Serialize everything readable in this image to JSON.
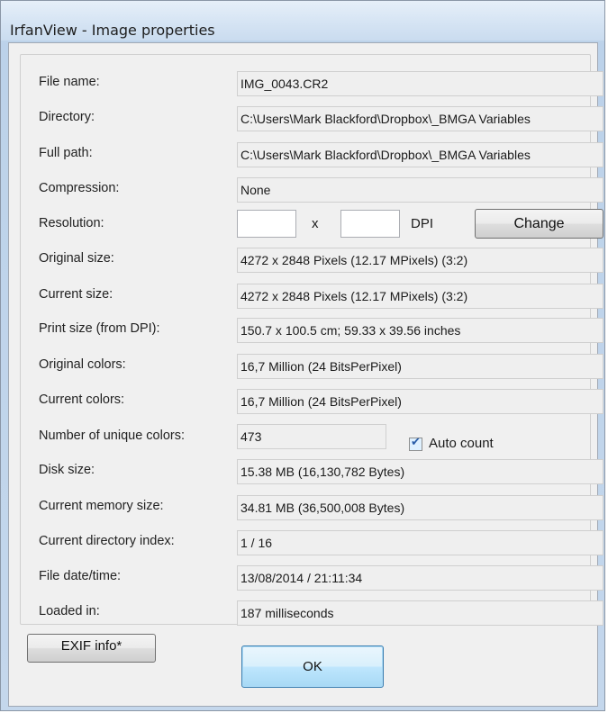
{
  "window": {
    "title": "IrfanView - Image properties"
  },
  "fields": [
    {
      "label": "File name:",
      "value": "IMG_0043.CR2"
    },
    {
      "label": "Directory:",
      "value": "C:\\Users\\Mark Blackford\\Dropbox\\_BMGA Variables"
    },
    {
      "label": "Full path:",
      "value": "C:\\Users\\Mark Blackford\\Dropbox\\_BMGA Variables"
    },
    {
      "label": "Compression:",
      "value": "None"
    },
    {
      "label": "Original size:",
      "value": "4272 x 2848  Pixels (12.17 MPixels) (3:2)"
    },
    {
      "label": "Current size:",
      "value": "4272 x 2848  Pixels (12.17 MPixels) (3:2)"
    },
    {
      "label": "Print size (from DPI):",
      "value": "150.7 x 100.5 cm; 59.33 x 39.56 inches"
    },
    {
      "label": "Original colors:",
      "value": "16,7 Million  (24 BitsPerPixel)"
    },
    {
      "label": "Current colors:",
      "value": "16,7 Million  (24 BitsPerPixel)"
    },
    {
      "label": "Disk size:",
      "value": "15.38 MB (16,130,782 Bytes)"
    },
    {
      "label": "Current memory size:",
      "value": "34.81  MB (36,500,008 Bytes)"
    },
    {
      "label": "Current directory index:",
      "value": "1  /  16"
    },
    {
      "label": "File date/time:",
      "value": "13/08/2014 / 21:11:34"
    },
    {
      "label": "Loaded in:",
      "value": "187 milliseconds"
    }
  ],
  "resolution": {
    "label": "Resolution:",
    "x_value": "",
    "y_value": "",
    "separator": "x",
    "unit": "DPI",
    "change_button": "Change"
  },
  "unique_colors": {
    "label": "Number of unique colors:",
    "value": "473",
    "auto_count_label": "Auto count",
    "auto_count_checked": true,
    "check_glyph": "✔"
  },
  "buttons": {
    "exif": "EXIF info*",
    "ok": "OK"
  }
}
